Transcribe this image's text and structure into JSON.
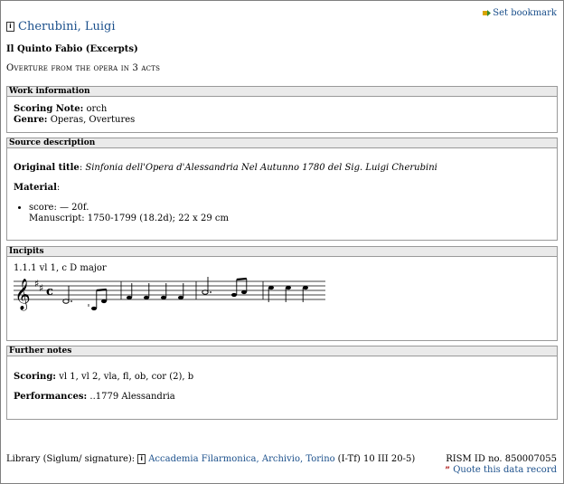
{
  "header": {
    "bookmark_label": "Set bookmark",
    "composer": "Cherubini, Luigi",
    "work_title": "Il Quinto Fabio (Excerpts)",
    "subtitle": "Overture from the opera in 3 acts"
  },
  "work_info": {
    "heading": "Work information",
    "scoring_note_label": "Scoring Note:",
    "scoring_note_value": "orch",
    "genre_label": "Genre:",
    "genre_value": "Operas, Overtures"
  },
  "source": {
    "heading": "Source description",
    "original_title_label": "Original title",
    "original_title_value": "Sinfonia dell'Opera d'Alessandria Nel Autunno 1780 del Sig. Luigi Cherubini",
    "material_label": "Material",
    "material_item": "score: — 20f.",
    "material_detail": "Manuscript: 1750-1799 (18.2d); 22 x 29 cm"
  },
  "incipits": {
    "heading": "Incipits",
    "incipit_label": "1.1.1 vl 1, c D major"
  },
  "notes": {
    "heading": "Further notes",
    "scoring_label": "Scoring:",
    "scoring_value": "vl 1, vl 2, vla, fl, ob, cor (2), b",
    "performances_label": "Performances:",
    "performances_value": "..1779 Alessandria"
  },
  "footer": {
    "library_label": "Library (Siglum/ signature):",
    "library_link": "Accademia Filarmonica, Archivio, Torino",
    "siglum": "(I-Tf) 10 III 20-5)",
    "rism_id": "RISM ID no. 850007055",
    "quote_label": "Quote this data record"
  },
  "colors": {
    "link": "#1a4f8b",
    "section_head_bg": "#eaeaea",
    "quote_icon": "#b22222"
  },
  "icons": [
    "bookmark-icon",
    "info-icon",
    "quote-icon"
  ]
}
